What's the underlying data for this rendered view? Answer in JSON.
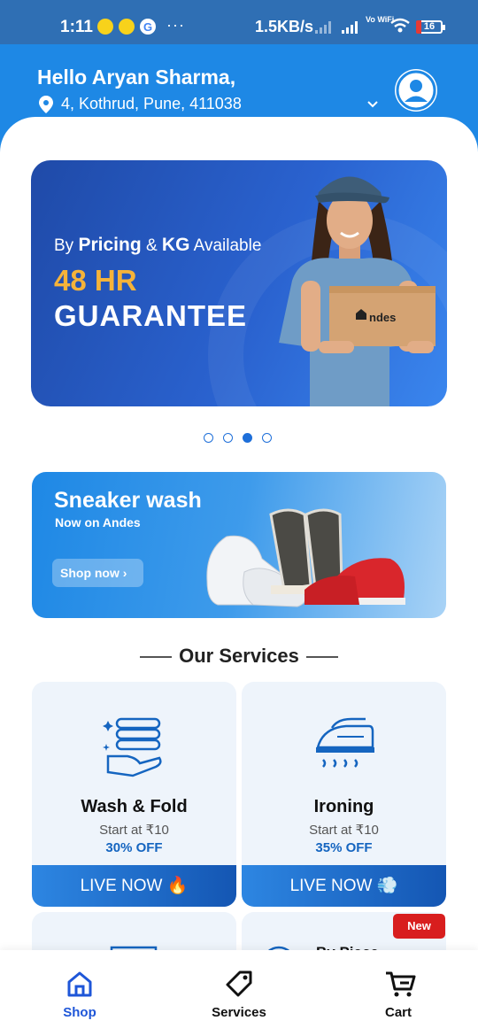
{
  "status_bar": {
    "time": "1:11",
    "notification_icons": [
      "snapchat-icon",
      "snapchat-icon",
      "google-icon"
    ],
    "more": "···",
    "speed": "1.5KB/s",
    "volte": "Vo WiFi",
    "battery": "16"
  },
  "header": {
    "greeting": "Hello Aryan Sharma,",
    "address": "4, Kothrud, Pune, 411038"
  },
  "hero": {
    "sub_prefix": "By",
    "sub_bold1": "Pricing",
    "sub_mid": "&",
    "sub_bold2": "KG",
    "sub_suffix": "Available",
    "line1": "48 HR",
    "line2": "GUARANTEE",
    "box_brand": "ndes"
  },
  "carousel": {
    "pages": 4,
    "active_index": 2
  },
  "promo": {
    "title": "Sneaker wash",
    "subtitle": "Now on Andes",
    "button": "Shop now"
  },
  "section": {
    "title": "Our Services"
  },
  "services": [
    {
      "name": "Wash & Fold",
      "price": "Start at ₹10",
      "offer": "30% OFF",
      "cta": "LIVE NOW",
      "cta_icon": "fire-icon"
    },
    {
      "name": "Ironing",
      "price": "Start at ₹10",
      "offer": "35% OFF",
      "cta": "LIVE NOW",
      "cta_icon": "steam-icon"
    }
  ],
  "partial_cards": [
    {
      "label": ""
    },
    {
      "label": "By Piece",
      "badge": "New"
    }
  ],
  "bottom_nav": [
    {
      "label": "Shop",
      "icon": "home-icon",
      "active": true
    },
    {
      "label": "Services",
      "icon": "tag-icon",
      "active": false
    },
    {
      "label": "Cart",
      "icon": "cart-icon",
      "active": false
    }
  ],
  "colors": {
    "primary": "#1E88E5",
    "accent": "#F5B33A",
    "badge": "#D81E1E",
    "nav_active": "#1E56D8"
  }
}
